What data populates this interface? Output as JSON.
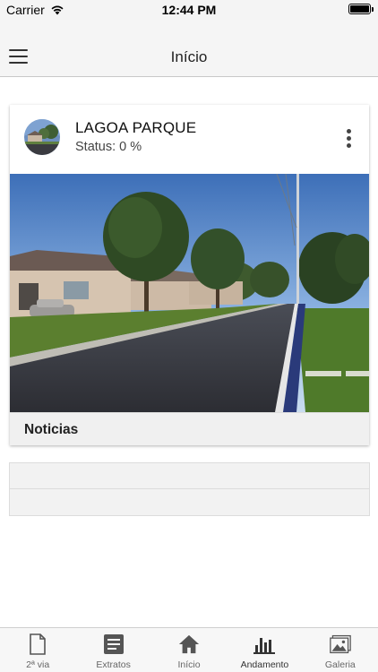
{
  "status_bar": {
    "carrier": "Carrier",
    "time": "12:44 PM"
  },
  "nav": {
    "title": "Início"
  },
  "card": {
    "title": "LAGOA PARQUE",
    "status": "Status: 0 %",
    "footer_label": "Noticias"
  },
  "list_rows": [
    {},
    {}
  ],
  "tabs": [
    {
      "label": "2ª via",
      "icon": "document-icon"
    },
    {
      "label": "Extratos",
      "icon": "statement-icon"
    },
    {
      "label": "Início",
      "icon": "home-icon"
    },
    {
      "label": "Andamento",
      "icon": "bar-chart-icon"
    },
    {
      "label": "Galeria",
      "icon": "gallery-icon"
    }
  ],
  "colors": {
    "navbar_bg": "#f5f5f5",
    "icon_gray": "#555555",
    "tab_label": "#666666"
  }
}
